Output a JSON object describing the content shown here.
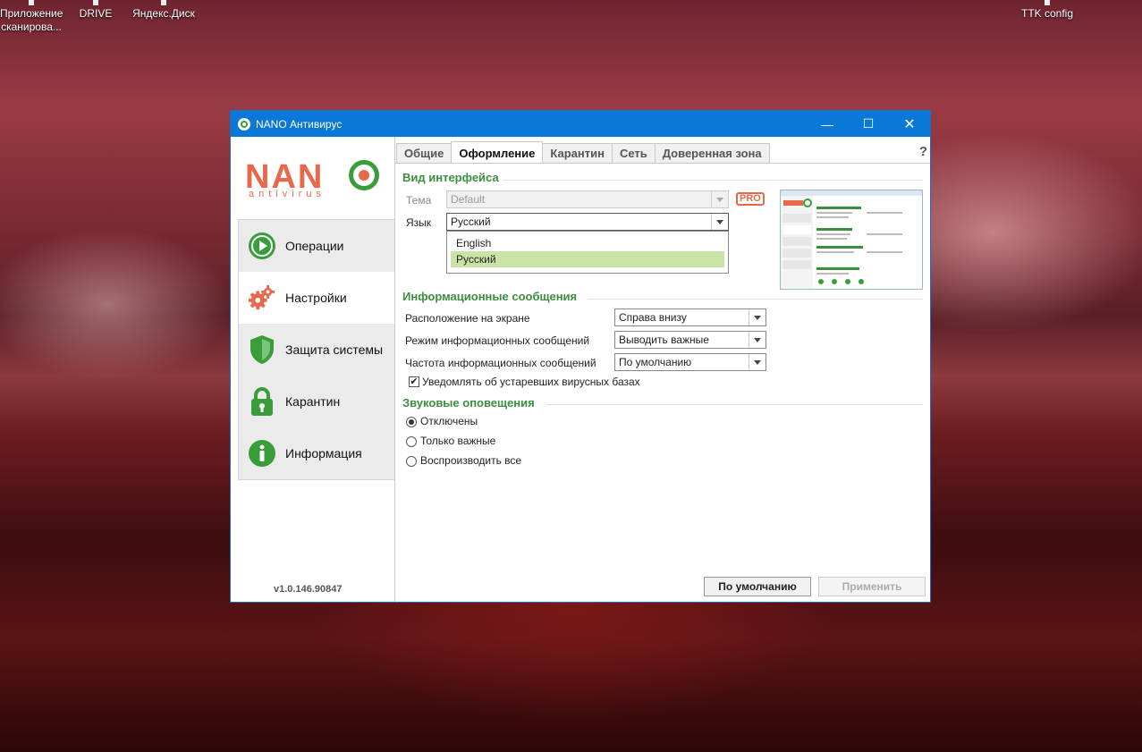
{
  "desktop": {
    "icons": [
      {
        "label_line1": "Приложение",
        "label_line2": "сканирова..."
      },
      {
        "label_line1": "DRIVE",
        "label_line2": ""
      },
      {
        "label_line1": "Яндекс.Диск",
        "label_line2": ""
      },
      {
        "label_line1": "TTK config",
        "label_line2": ""
      }
    ]
  },
  "window": {
    "title": "NANO Антивирус",
    "controls": {
      "minimize": "—",
      "maximize": "☐",
      "close": "✕"
    }
  },
  "logo": {
    "brand": "NAN",
    "sub": "antivirus"
  },
  "sidebar": {
    "items": [
      {
        "label": "Операции",
        "icon": "play-icon"
      },
      {
        "label": "Настройки",
        "icon": "gears-icon"
      },
      {
        "label": "Защита системы",
        "icon": "shield-icon"
      },
      {
        "label": "Карантин",
        "icon": "lock-icon"
      },
      {
        "label": "Информация",
        "icon": "info-icon"
      }
    ],
    "version": "v1.0.146.90847"
  },
  "tabs": [
    "Общие",
    "Оформление",
    "Карантин",
    "Сеть",
    "Доверенная зона"
  ],
  "help": "?",
  "interface": {
    "section_title": "Вид интерфейса",
    "theme_label": "Тема",
    "theme_value": "Default",
    "pro": "PRO",
    "lang_label": "Язык",
    "lang_value": "Русский",
    "lang_options": [
      "English",
      "Русский"
    ]
  },
  "info_messages": {
    "section_title": "Информационные сообщения",
    "position_label": "Расположение на экране",
    "position_value": "Справа внизу",
    "mode_label": "Режим информационных сообщений",
    "mode_value": "Выводить важные",
    "freq_label": "Частота информационных сообщений",
    "freq_value": "По умолчанию",
    "outdated_label": "Уведомлять об устаревших вирусных базах",
    "outdated_checked": true
  },
  "sound": {
    "section_title": "Звуковые оповещения",
    "options": [
      "Отключены",
      "Только важные",
      "Воспроизводить все"
    ],
    "selected": "Отключены"
  },
  "buttons": {
    "defaults": "По умолчанию",
    "apply": "Применить"
  },
  "colors": {
    "accent_green": "#3a8f3c",
    "brand_orange": "#e8694a",
    "titlebar": "#0a78d7",
    "selection": "#cce3a8"
  }
}
